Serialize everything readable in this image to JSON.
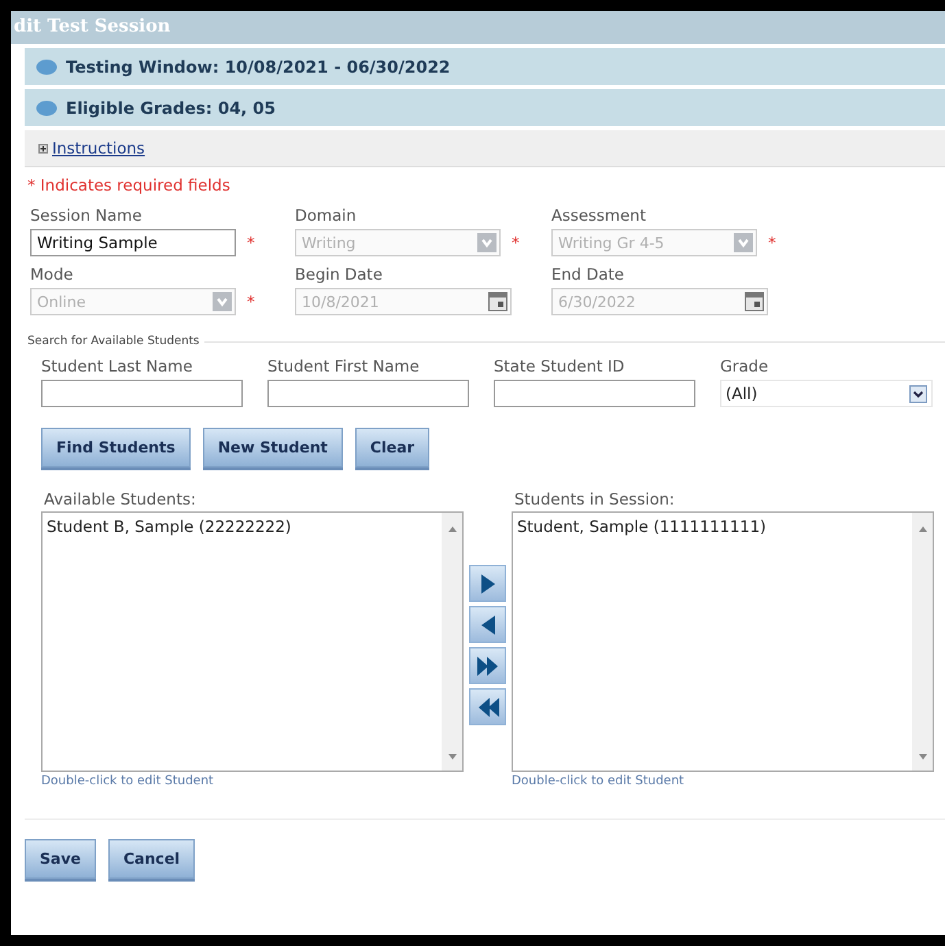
{
  "window": {
    "title": "dit Test Session"
  },
  "info_bars": [
    "Testing Window: 10/08/2021 - 06/30/2022",
    "Eligible Grades: 04, 05"
  ],
  "instructions": {
    "label": "Instructions",
    "expanded": false
  },
  "required_note": "* Indicates required fields",
  "session_fields": [
    {
      "kind": "text",
      "label": "Session Name",
      "value": "Writing Sample",
      "disabled": false,
      "required_mark": "*"
    },
    {
      "kind": "select",
      "label": "Domain",
      "value": "Writing",
      "disabled": true,
      "required_mark": "*"
    },
    {
      "kind": "select",
      "label": "Assessment",
      "value": "Writing Gr 4-5",
      "disabled": true,
      "required_mark": "*"
    },
    {
      "kind": "select",
      "label": "Mode",
      "value": "Online",
      "disabled": true,
      "required_mark": "*"
    },
    {
      "kind": "date",
      "label": "Begin Date",
      "value": "10/8/2021",
      "disabled": true
    },
    {
      "kind": "date",
      "label": "End Date",
      "value": "6/30/2022",
      "disabled": true
    }
  ],
  "search": {
    "legend": "Search for Available Students",
    "fields": [
      {
        "kind": "text",
        "label": "Student Last Name"
      },
      {
        "kind": "text",
        "label": "Student First Name"
      },
      {
        "kind": "text",
        "label": "State Student ID"
      },
      {
        "kind": "select",
        "label": "Grade",
        "value": "(All)"
      }
    ],
    "buttons": [
      "Find Students",
      "New Student",
      "Clear"
    ]
  },
  "lists": [
    {
      "label": "Available Students:",
      "items": [
        "Student B, Sample (22222222)"
      ],
      "hint": "Double-click to edit Student"
    },
    {
      "label": "Students in Session:",
      "items": [
        "Student, Sample (1111111111)"
      ],
      "hint": "Double-click to edit Student"
    }
  ],
  "move_buttons": [
    {
      "kind": "add"
    },
    {
      "kind": "remove"
    },
    {
      "kind": "add-all"
    },
    {
      "kind": "remove-all"
    }
  ],
  "footer_buttons": [
    "Save",
    "Cancel"
  ]
}
